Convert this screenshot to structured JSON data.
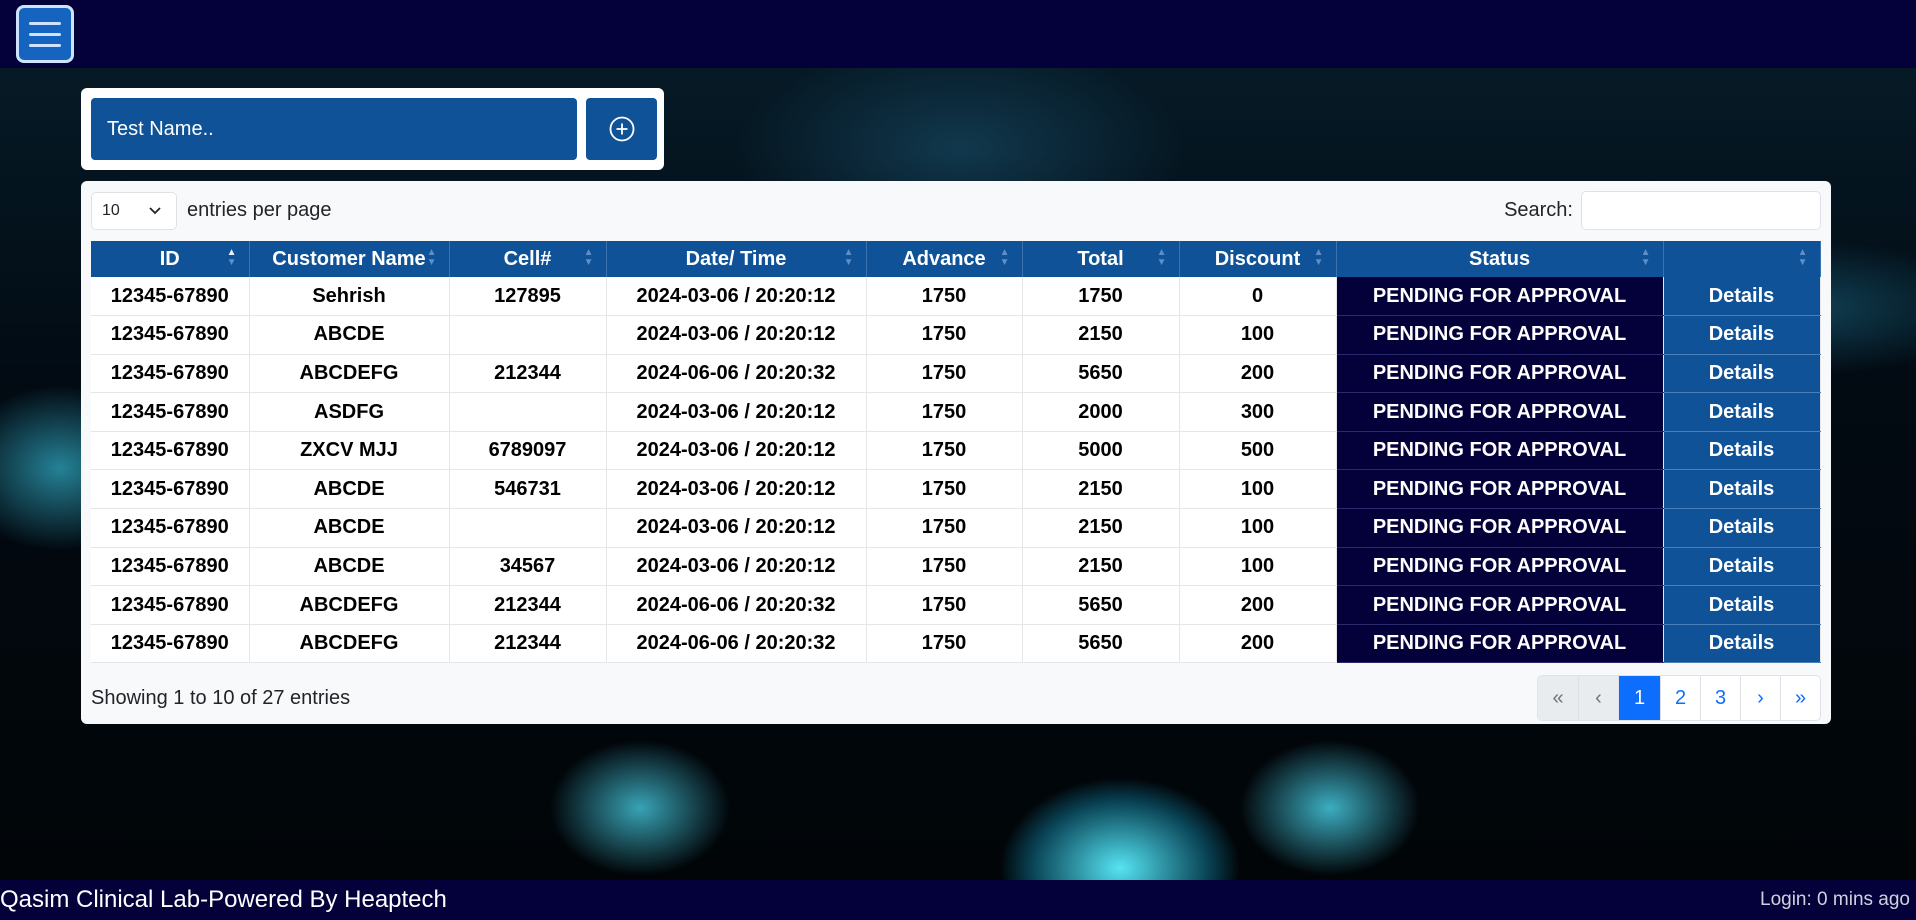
{
  "search_bar": {
    "test_placeholder": "Test Name.."
  },
  "table_controls": {
    "per_page_value": "10",
    "per_page_label": "entries per page",
    "search_label": "Search:"
  },
  "columns": [
    "ID",
    "Customer Name",
    "Cell#",
    "Date/ Time",
    "Advance",
    "Total",
    "Discount",
    "Status",
    ""
  ],
  "rows": [
    {
      "id": "12345-67890",
      "name": "Sehrish",
      "cell": "127895",
      "datetime": "2024-03-06 / 20:20:12",
      "advance": "1750",
      "total": "1750",
      "discount": "0",
      "status": "PENDING FOR APPROVAL",
      "action": "Details"
    },
    {
      "id": "12345-67890",
      "name": "ABCDE",
      "cell": "",
      "datetime": "2024-03-06 / 20:20:12",
      "advance": "1750",
      "total": "2150",
      "discount": "100",
      "status": "PENDING FOR APPROVAL",
      "action": "Details"
    },
    {
      "id": "12345-67890",
      "name": "ABCDEFG",
      "cell": "212344",
      "datetime": "2024-06-06 / 20:20:32",
      "advance": "1750",
      "total": "5650",
      "discount": "200",
      "status": "PENDING FOR APPROVAL",
      "action": "Details"
    },
    {
      "id": "12345-67890",
      "name": "ASDFG",
      "cell": "",
      "datetime": "2024-03-06 / 20:20:12",
      "advance": "1750",
      "total": "2000",
      "discount": "300",
      "status": "PENDING FOR APPROVAL",
      "action": "Details"
    },
    {
      "id": "12345-67890",
      "name": "ZXCV MJJ",
      "cell": "6789097",
      "datetime": "2024-03-06 / 20:20:12",
      "advance": "1750",
      "total": "5000",
      "discount": "500",
      "status": "PENDING FOR APPROVAL",
      "action": "Details"
    },
    {
      "id": "12345-67890",
      "name": "ABCDE",
      "cell": "546731",
      "datetime": "2024-03-06 / 20:20:12",
      "advance": "1750",
      "total": "2150",
      "discount": "100",
      "status": "PENDING FOR APPROVAL",
      "action": "Details"
    },
    {
      "id": "12345-67890",
      "name": "ABCDE",
      "cell": "",
      "datetime": "2024-03-06 / 20:20:12",
      "advance": "1750",
      "total": "2150",
      "discount": "100",
      "status": "PENDING FOR APPROVAL",
      "action": "Details"
    },
    {
      "id": "12345-67890",
      "name": "ABCDE",
      "cell": "34567",
      "datetime": "2024-03-06 / 20:20:12",
      "advance": "1750",
      "total": "2150",
      "discount": "100",
      "status": "PENDING FOR APPROVAL",
      "action": "Details"
    },
    {
      "id": "12345-67890",
      "name": "ABCDEFG",
      "cell": "212344",
      "datetime": "2024-06-06 / 20:20:32",
      "advance": "1750",
      "total": "5650",
      "discount": "200",
      "status": "PENDING FOR APPROVAL",
      "action": "Details"
    },
    {
      "id": "12345-67890",
      "name": "ABCDEFG",
      "cell": "212344",
      "datetime": "2024-06-06 / 20:20:32",
      "advance": "1750",
      "total": "5650",
      "discount": "200",
      "status": "PENDING FOR APPROVAL",
      "action": "Details"
    }
  ],
  "info": {
    "showing": "Showing 1 to 10 of 27 entries"
  },
  "pagination": {
    "first": "«",
    "prev": "‹",
    "pages": [
      "1",
      "2",
      "3"
    ],
    "active_page": "1",
    "next": "›",
    "last": "»"
  },
  "footer": {
    "brand": "Qasim Clinical Lab-Powered By Heaptech",
    "login": "Login: 0 mins ago"
  },
  "colors": {
    "navy": "#04003a",
    "accent_blue": "#0f5297",
    "page_active": "#0d6efd"
  },
  "icons": {
    "menu": "hamburger-menu-icon",
    "add": "plus-circle-icon",
    "select": "chevron-down-icon",
    "sort": "sort-arrows-icon"
  }
}
